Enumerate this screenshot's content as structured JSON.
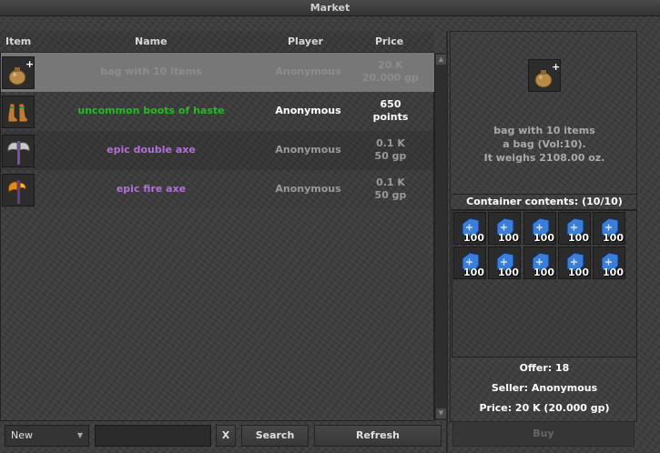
{
  "window": {
    "title": "Market"
  },
  "table": {
    "headers": {
      "item": "Item",
      "name": "Name",
      "player": "Player",
      "price": "Price"
    },
    "rows": [
      {
        "icon": "bag-icon",
        "name": "bag with 10 items",
        "name_color": "#8c8c8c",
        "player": "Anonymous",
        "player_color": "#8c8c8c",
        "price_line1": "20 K",
        "price_line2": "20.000 gp",
        "price_color": "#8c8c8c",
        "selected": true
      },
      {
        "icon": "boots-icon",
        "name": "uncommon boots of haste",
        "name_color": "#22bb22",
        "player": "Anonymous",
        "player_color": "#ffffff",
        "price_line1": "650",
        "price_line2": "points",
        "price_color": "#ffffff",
        "selected": false
      },
      {
        "icon": "double-axe-icon",
        "name": "epic double axe",
        "name_color": "#b070d8",
        "player": "Anonymous",
        "player_color": "#9a9a9a",
        "price_line1": "0.1 K",
        "price_line2": "50 gp",
        "price_color": "#9a9a9a",
        "selected": false
      },
      {
        "icon": "fire-axe-icon",
        "name": "epic fire axe",
        "name_color": "#b070d8",
        "player": "Anonymous",
        "player_color": "#9a9a9a",
        "price_line1": "0.1 K",
        "price_line2": "50 gp",
        "price_color": "#9a9a9a",
        "selected": false
      }
    ]
  },
  "details": {
    "line1": "bag with 10 items",
    "line2": "a bag (Vol:10).",
    "line3": "It weighs 2108.00 oz.",
    "container_label": "Container contents: (10/10)",
    "slots": [
      {
        "icon": "blue-rune-icon",
        "count": "100"
      },
      {
        "icon": "blue-rune-icon",
        "count": "100"
      },
      {
        "icon": "blue-rune-icon",
        "count": "100"
      },
      {
        "icon": "blue-rune-icon",
        "count": "100"
      },
      {
        "icon": "blue-rune-icon",
        "count": "100"
      },
      {
        "icon": "blue-rune-icon",
        "count": "100"
      },
      {
        "icon": "blue-rune-icon",
        "count": "100"
      },
      {
        "icon": "blue-rune-icon",
        "count": "100"
      },
      {
        "icon": "blue-rune-icon",
        "count": "100"
      },
      {
        "icon": "blue-rune-icon",
        "count": "100"
      }
    ],
    "offer": "Offer: 18",
    "seller": "Seller: Anonymous",
    "price": "Price: 20 K (20.000 gp)",
    "buy_label": "Buy"
  },
  "toolbar": {
    "filter_value": "New",
    "search_value": "",
    "clear_label": "X",
    "search_label": "Search",
    "refresh_label": "Refresh"
  }
}
